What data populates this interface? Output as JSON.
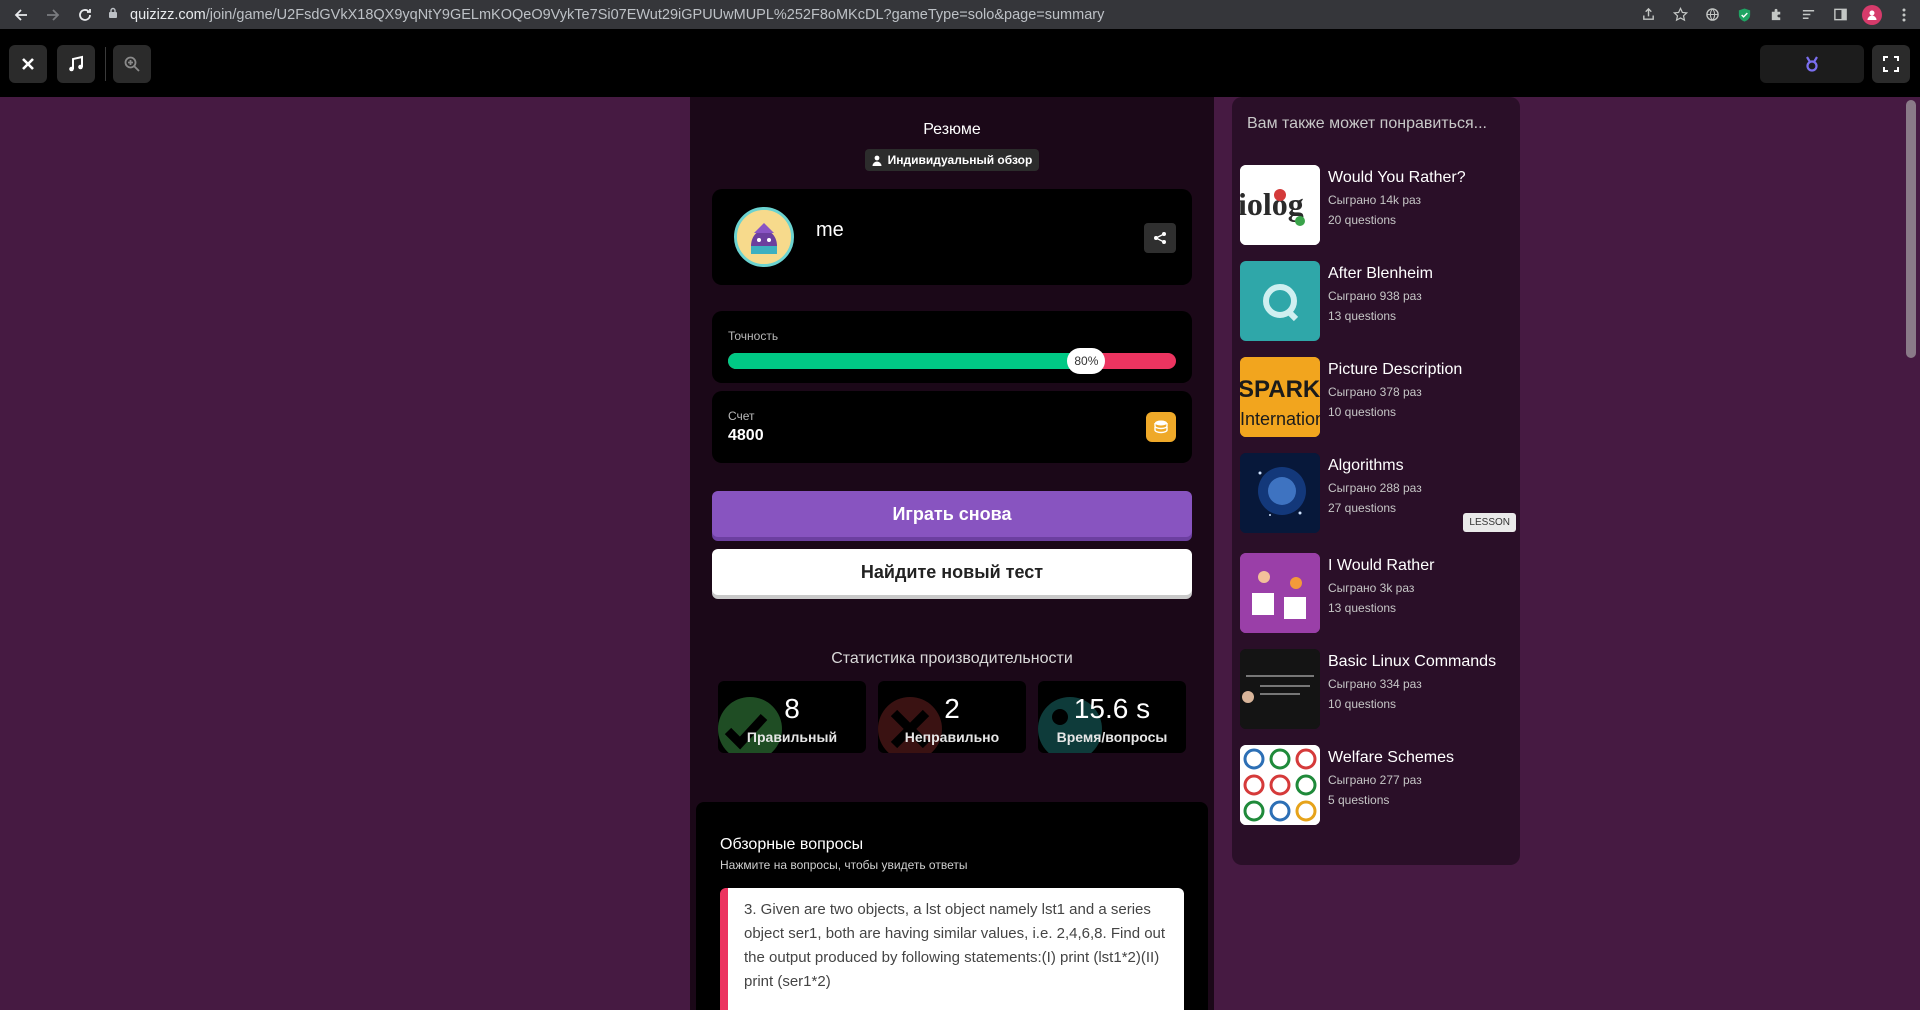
{
  "browser": {
    "url_domain": "quizizz.com",
    "url_path": "/join/game/U2FsdGVkX18QX9yqNtY9GELmKOQeO9VykTe7Si07EWut29iGPUUwMUPL%252F8oMKcDL?gameType=solo&page=summary"
  },
  "summary": {
    "title": "Резюме",
    "badge": "Индивидуальный обзор",
    "player_name": "me",
    "accuracy_label": "Точность",
    "accuracy_text": "80%",
    "accuracy_value": 0.8,
    "score_label": "Счет",
    "score_value": "4800",
    "play_again": "Играть снова",
    "find_new": "Найдите новый тест"
  },
  "stats": {
    "title": "Статистика производительности",
    "correct_value": "8",
    "correct_label": "Правильный",
    "incorrect_value": "2",
    "incorrect_label": "Неправильно",
    "time_value": "15.6 s",
    "time_label": "Время/вопросы"
  },
  "review": {
    "title": "Обзорные вопросы",
    "subtitle": "Нажмите на вопросы, чтобы увидеть ответы",
    "question": "3.   Given are two objects, a lst object namely lst1 and a series object ser1, both are having similar values, i.e. 2,4,6,8. Find out the output produced by following statements:(I) print (lst1*2)(II) print (ser1*2)"
  },
  "recommendations": {
    "heading": "Вам также может понравиться...",
    "items": [
      {
        "title": "Would You Rather?",
        "played": "Сыграно 14k раз",
        "questions": "20 questions"
      },
      {
        "title": "After Blenheim",
        "played": "Сыграно 938 раз",
        "questions": "13 questions"
      },
      {
        "title": "Picture Description",
        "played": "Сыграно 378 раз",
        "questions": "10 questions"
      },
      {
        "title": "Algorithms",
        "played": "Сыграно 288 раз",
        "questions": "27 questions",
        "tag": "LESSON"
      },
      {
        "title": "I Would Rather",
        "played": "Сыграно 3k раз",
        "questions": "13 questions"
      },
      {
        "title": "Basic Linux Commands",
        "played": "Сыграно 334 раз",
        "questions": "10 questions"
      },
      {
        "title": "Welfare Schemes",
        "played": "Сыграно 277 раз",
        "questions": "5 questions"
      }
    ],
    "thumb_texts": {
      "t1": "iolog",
      "t3a": "SPARK",
      "t3b": "Internation"
    }
  },
  "colors": {
    "page_bg": "#461a42",
    "correct": "#00c985",
    "incorrect": "#ec3460",
    "primary_button": "#8854c0",
    "coin": "#efa929"
  }
}
